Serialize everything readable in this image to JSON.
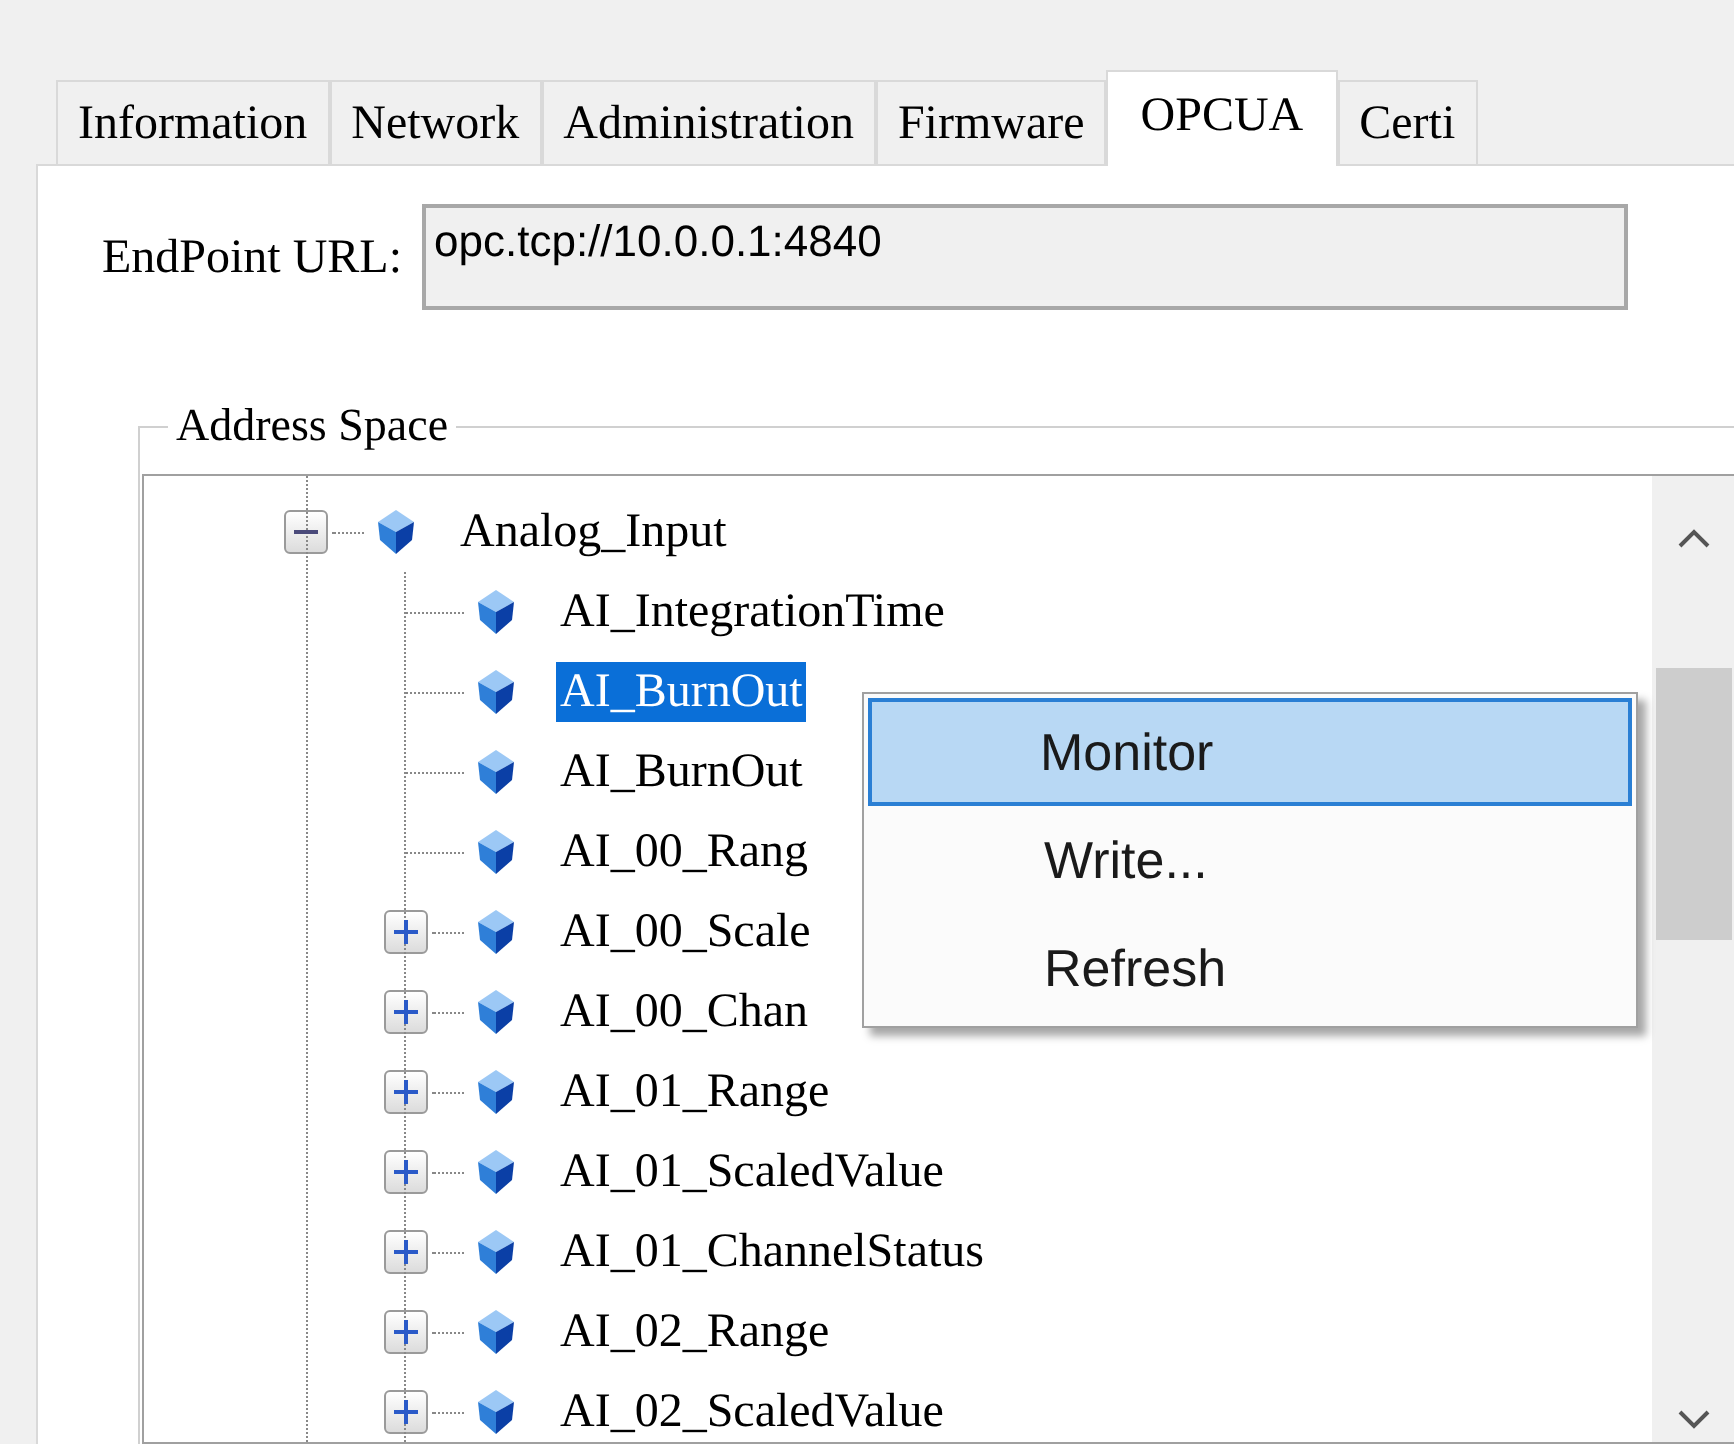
{
  "tabs": [
    {
      "label": "Information",
      "selected": false
    },
    {
      "label": "Network",
      "selected": false
    },
    {
      "label": "Administration",
      "selected": false
    },
    {
      "label": "Firmware",
      "selected": false
    },
    {
      "label": "OPCUA",
      "selected": true
    },
    {
      "label": "Certi",
      "selected": false
    }
  ],
  "endpoint": {
    "label": "EndPoint URL:",
    "value": "opc.tcp://10.0.0.1:4840"
  },
  "address_space": {
    "title": "Address Space",
    "tree": [
      {
        "label": "Analog_Input",
        "kind": "object",
        "expanded": true,
        "selected": false,
        "children": [
          {
            "label": "AI_IntegrationTime",
            "kind": "variable",
            "selected": false
          },
          {
            "label": "AI_BurnOut",
            "kind": "variable",
            "selected": true
          },
          {
            "label": "AI_BurnOut",
            "kind": "variable",
            "selected": false
          },
          {
            "label": "AI_00_Rang",
            "kind": "variable",
            "selected": false
          },
          {
            "label": "AI_00_Scale",
            "kind": "object",
            "expanded": false,
            "selected": false
          },
          {
            "label": "AI_00_Chan",
            "kind": "object",
            "expanded": false,
            "selected": false
          },
          {
            "label": "AI_01_Range",
            "kind": "object",
            "expanded": false,
            "selected": false
          },
          {
            "label": "AI_01_ScaledValue",
            "kind": "object",
            "expanded": false,
            "selected": false
          },
          {
            "label": "AI_01_ChannelStatus",
            "kind": "object",
            "expanded": false,
            "selected": false
          },
          {
            "label": "AI_02_Range",
            "kind": "object",
            "expanded": false,
            "selected": false
          },
          {
            "label": "AI_02_ScaledValue",
            "kind": "object",
            "expanded": false,
            "selected": false
          }
        ]
      }
    ]
  },
  "context_menu": {
    "items": [
      {
        "label": "Monitor",
        "selected": true
      },
      {
        "label": "Write...",
        "selected": false
      },
      {
        "label": "Refresh",
        "selected": false
      }
    ]
  }
}
